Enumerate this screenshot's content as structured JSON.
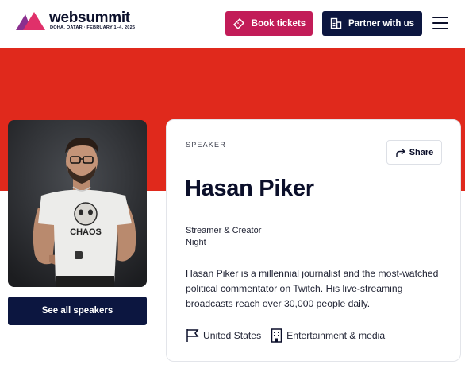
{
  "header": {
    "logo_text": "websummit",
    "logo_subtitle": "DOHA, QATAR · FEBRUARY 1–4, 2026",
    "book_tickets_label": "Book tickets",
    "partner_label": "Partner with us"
  },
  "speaker": {
    "eyebrow": "SPEAKER",
    "share_label": "Share",
    "name": "Hasan Piker",
    "role_line1": "Streamer & Creator",
    "role_line2": "Night",
    "bio": "Hasan Piker is a millennial journalist and the most-watched political commentator on Twitch. His live-streaming broadcasts reach over 30,000 people daily.",
    "country": "United States",
    "category": "Entertainment & media",
    "photo_shirt_text": "CHAOS"
  },
  "left": {
    "see_all_label": "See all speakers"
  },
  "colors": {
    "brand_pink": "#c21c58",
    "navy": "#0c1640",
    "band_red": "#e0291c"
  },
  "icons": [
    "ticket-icon",
    "building-icon",
    "hamburger-menu-icon",
    "share-icon",
    "flag-icon",
    "office-building-icon"
  ]
}
